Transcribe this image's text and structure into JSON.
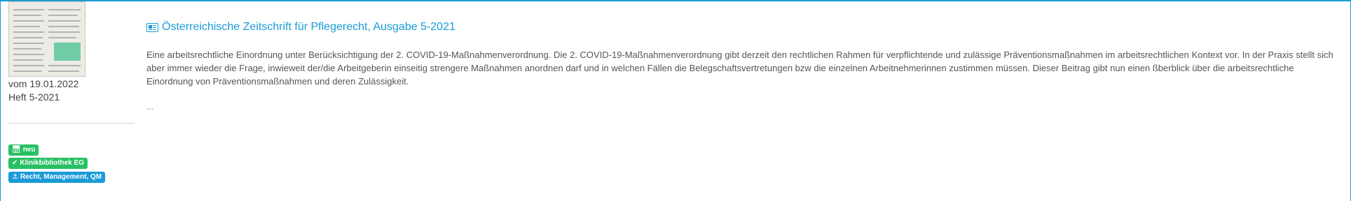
{
  "article": {
    "title": "Österreichische Zeitschrift für Pflegerecht, Ausgabe 5-2021",
    "description": "Eine arbeitsrechtliche Einordnung unter Berücksichtigung der 2. COVID-19-Maßnahmenverordnung. Die 2. COVID-19-Maßnahmenverordnung gibt derzeit den rechtlichen Rahmen für verpflichtende und zulässige Präventionsmaßnahmen im arbeitsrechtlichen Kontext vor. In der Praxis stellt sich aber immer wieder die Frage, inwieweit der/die Arbeitgeberin einseitig strengere Maßnahmen anordnen darf und in welchen Fällen die Belegschaftsvertretungen bzw die einzelnen Arbeitnehmerinnen zustimmen müssen. Dieser Beitrag gibt nun einen ßberblick über die arbeitsrechtliche Einordnung von Präventionsmaßnahmen und deren Zulässigkeit.",
    "more": "...",
    "date": "vom 19.01.2022",
    "issue": "Heft 5-2021",
    "icon": "newspaper-icon"
  },
  "badges": [
    {
      "label": "neu",
      "icon": "calendar-icon",
      "color": "#27c063"
    },
    {
      "label": "Klinikbibliothek EG",
      "icon": "check-icon",
      "color": "#27c063"
    },
    {
      "label": "Recht, Management, QM",
      "icon": "anchor-icon",
      "color": "#1a9bd7"
    }
  ],
  "colors": {
    "accent": "#1a9bd7",
    "green": "#27c063",
    "text": "#555555"
  }
}
